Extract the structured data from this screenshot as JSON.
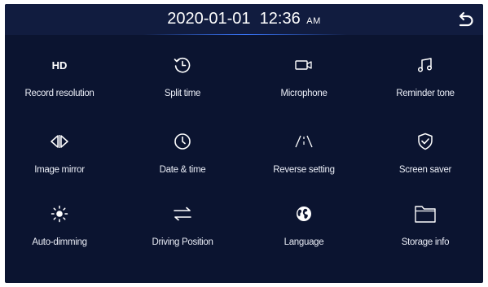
{
  "status_bar": {
    "date": "2020-01-01",
    "time": "12:36",
    "ampm": "AM"
  },
  "back_icon": "back-arrow-icon",
  "colors": {
    "background": "#0b1430",
    "header": "#111c3f",
    "accent_line": "#3a78ff",
    "text": "#e9ecf5"
  },
  "menu": {
    "items": [
      {
        "label": "Record resolution",
        "icon": "hd-icon",
        "icon_text": "HD"
      },
      {
        "label": "Split time",
        "icon": "clock-cycle-icon"
      },
      {
        "label": "Microphone",
        "icon": "camcorder-icon"
      },
      {
        "label": "Reminder tone",
        "icon": "music-note-icon"
      },
      {
        "label": "Image mirror",
        "icon": "mirror-icon"
      },
      {
        "label": "Date & time",
        "icon": "clock-icon"
      },
      {
        "label": "Reverse setting",
        "icon": "reverse-lines-icon"
      },
      {
        "label": "Screen saver",
        "icon": "shield-check-icon"
      },
      {
        "label": "Auto-dimming",
        "icon": "brightness-icon"
      },
      {
        "label": "Driving Position",
        "icon": "swap-arrows-icon"
      },
      {
        "label": "Language",
        "icon": "globe-icon"
      },
      {
        "label": "Storage info",
        "icon": "folder-icon"
      }
    ]
  }
}
